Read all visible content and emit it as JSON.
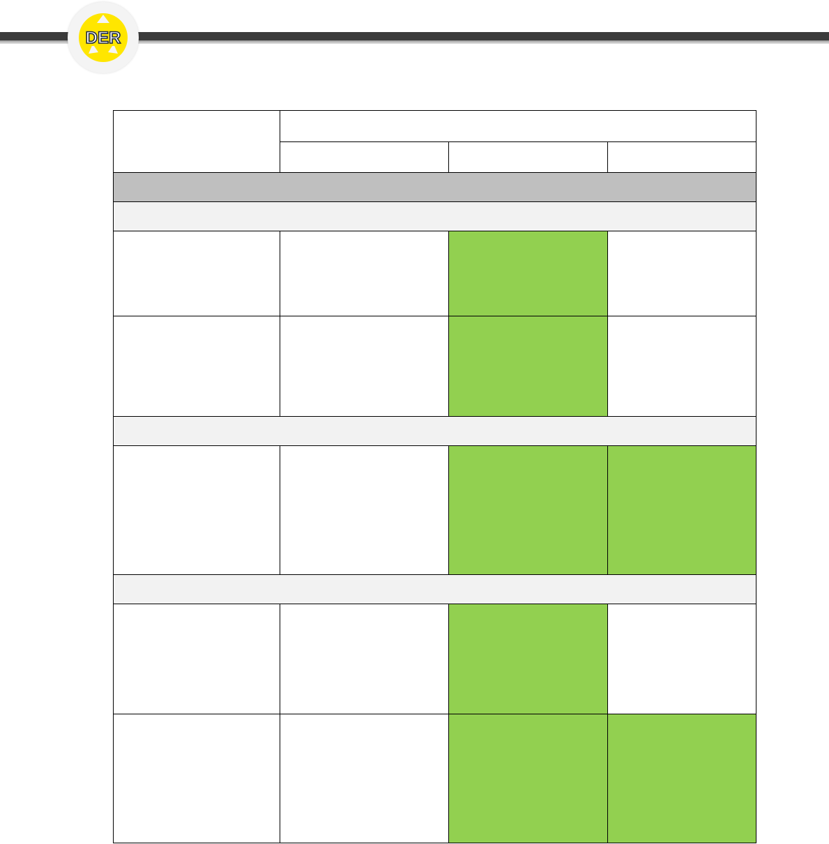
{
  "header": {
    "logo": {
      "name": "DER",
      "colors": {
        "ring": "#ffe600",
        "text": "#1f2a44",
        "badge": "#f4f4f4"
      }
    },
    "bar_color": "#3b3b3b"
  },
  "table": {
    "highlight_color": "#92d050",
    "section_color": "#bfbfbf",
    "group_color": "#f2f2f2",
    "header": {
      "corner": "",
      "span_title": "",
      "sub": [
        "",
        "",
        ""
      ]
    },
    "section": "",
    "groups": [
      {
        "label": "",
        "rows": [
          {
            "cells": [
              "",
              "",
              "",
              ""
            ],
            "highlight": [
              false,
              false,
              true,
              false
            ]
          },
          {
            "cells": [
              "",
              "",
              "",
              ""
            ],
            "highlight": [
              false,
              false,
              true,
              false
            ]
          }
        ]
      },
      {
        "label": "",
        "rows": [
          {
            "cells": [
              "",
              "",
              "",
              ""
            ],
            "highlight": [
              false,
              false,
              true,
              true
            ]
          }
        ]
      },
      {
        "label": "",
        "rows": [
          {
            "cells": [
              "",
              "",
              "",
              ""
            ],
            "highlight": [
              false,
              false,
              true,
              false
            ]
          },
          {
            "cells": [
              "",
              "",
              "",
              ""
            ],
            "highlight": [
              false,
              false,
              true,
              true
            ]
          }
        ]
      }
    ]
  }
}
